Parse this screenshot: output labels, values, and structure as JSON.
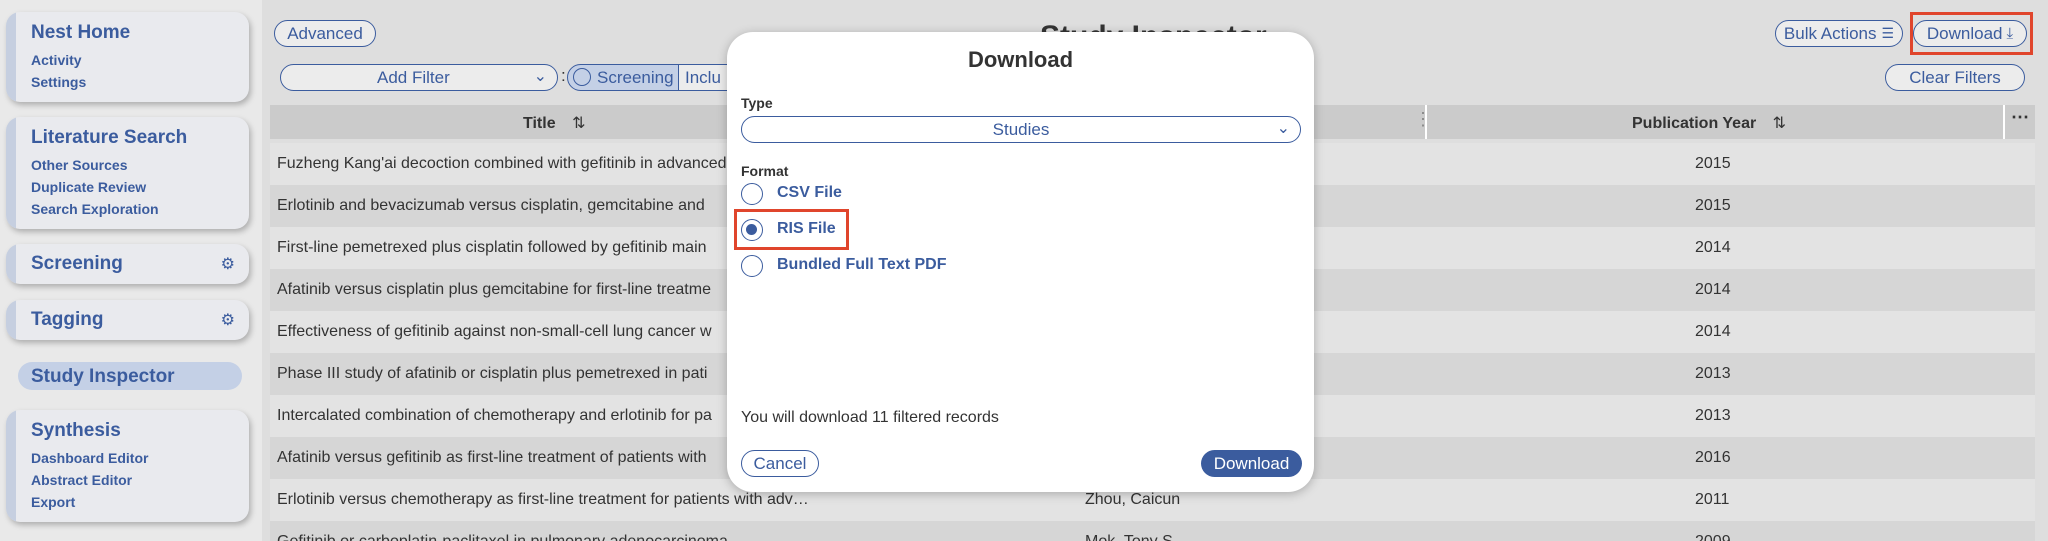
{
  "sidebar": {
    "home": {
      "title": "Nest Home",
      "items": [
        "Activity",
        "Settings"
      ]
    },
    "search": {
      "title": "Literature Search",
      "items": [
        "Other Sources",
        "Duplicate Review",
        "Search Exploration"
      ]
    },
    "screening": {
      "title": "Screening"
    },
    "tagging": {
      "title": "Tagging"
    },
    "inspector": {
      "title": "Study Inspector"
    },
    "synthesis": {
      "title": "Synthesis",
      "items": [
        "Dashboard Editor",
        "Abstract Editor",
        "Export"
      ]
    }
  },
  "toolbar": {
    "advanced": "Advanced",
    "page_title": "Study Inspector",
    "bulk_actions": "Bulk Actions",
    "download": "Download",
    "add_filter": "Add Filter",
    "colon": ":",
    "screening": "Screening",
    "included": "Inclu",
    "clear_filters": "Clear Filters"
  },
  "table": {
    "columns": {
      "title": "Title",
      "year": "Publication Year",
      "sort_icon": "⇅"
    },
    "rows": [
      {
        "title": "Fuzheng Kang'ai decoction combined with gefitinib in advanced",
        "author": "",
        "year": "2015"
      },
      {
        "title": "Erlotinib and bevacizumab versus cisplatin, gemcitabine and",
        "author": "",
        "year": "2015"
      },
      {
        "title": "First-line pemetrexed plus cisplatin followed by gefitinib main",
        "author": "",
        "year": "2014"
      },
      {
        "title": "Afatinib versus cisplatin plus gemcitabine for first-line treatme",
        "author": "",
        "year": "2014"
      },
      {
        "title": "Effectiveness of gefitinib against non-small-cell lung cancer w",
        "author": "",
        "year": "2014"
      },
      {
        "title": "Phase III study of afatinib or cisplatin plus pemetrexed in pati",
        "author": "",
        "year": "2013"
      },
      {
        "title": "Intercalated combination of chemotherapy and erlotinib for pa",
        "author": "",
        "year": "2013"
      },
      {
        "title": "Afatinib versus gefitinib as first-line treatment of patients with",
        "author": "",
        "year": "2016"
      },
      {
        "title": "Erlotinib versus chemotherapy as first-line treatment for patients with adv…",
        "author": "Zhou, Caicun",
        "year": "2011"
      },
      {
        "title": "Gefitinib or carboplatin-paclitaxel in pulmonary adenocarcinoma",
        "author": "Mok, Tony S.",
        "year": "2009"
      }
    ]
  },
  "modal": {
    "title": "Download",
    "type_label": "Type",
    "type_value": "Studies",
    "format_label": "Format",
    "options": [
      "CSV File",
      "RIS File",
      "Bundled Full Text PDF"
    ],
    "selected_index": 1,
    "info": "You will download 11 filtered records",
    "cancel": "Cancel",
    "confirm": "Download"
  },
  "colors": {
    "accent": "#3b5c9e",
    "highlight": "#e0452c"
  }
}
